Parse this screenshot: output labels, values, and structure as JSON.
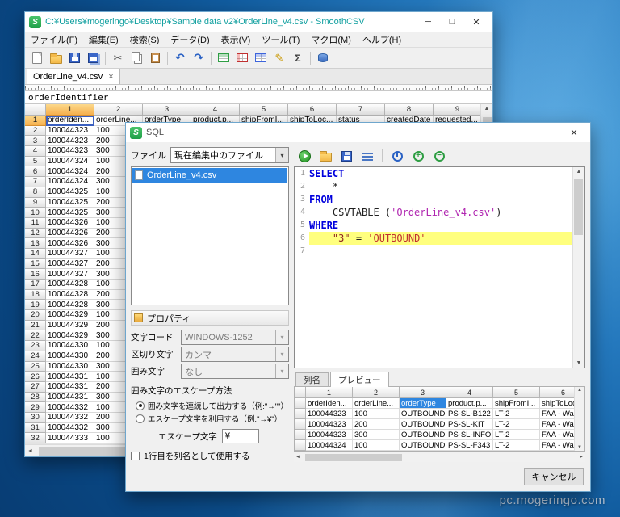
{
  "desktop": {
    "watermark": "pc.mogeringo.com"
  },
  "main_window": {
    "title": "C:¥Users¥mogeringo¥Desktop¥Sample data v2¥OrderLine_v4.csv - SmoothCSV",
    "logo_letter": "S",
    "window_buttons": {
      "minimize": "─",
      "maximize": "□",
      "close": "✕"
    },
    "menu": [
      {
        "name": "file",
        "label": "ファイル(F)"
      },
      {
        "name": "edit",
        "label": "編集(E)"
      },
      {
        "name": "search",
        "label": "検索(S)"
      },
      {
        "name": "data",
        "label": "データ(D)"
      },
      {
        "name": "view",
        "label": "表示(V)"
      },
      {
        "name": "tools",
        "label": "ツール(T)"
      },
      {
        "name": "macro",
        "label": "マクロ(M)"
      },
      {
        "name": "help",
        "label": "ヘルプ(H)"
      }
    ],
    "toolbar": [
      {
        "name": "new-file",
        "kind": "page"
      },
      {
        "name": "open-file",
        "kind": "folder"
      },
      {
        "name": "save",
        "kind": "floppy"
      },
      {
        "name": "save-all",
        "kind": "floppy2"
      },
      {
        "name": "sep1",
        "kind": "sep"
      },
      {
        "name": "cut",
        "kind": "cut",
        "glyph": "✂"
      },
      {
        "name": "copy",
        "kind": "copy"
      },
      {
        "name": "paste",
        "kind": "paste"
      },
      {
        "name": "sep2",
        "kind": "sep"
      },
      {
        "name": "undo",
        "kind": "undo",
        "glyph": "↶"
      },
      {
        "name": "redo",
        "kind": "redo",
        "glyph": "↷"
      },
      {
        "name": "sep3",
        "kind": "sep"
      },
      {
        "name": "insert-row",
        "kind": "tableg"
      },
      {
        "name": "delete-row",
        "kind": "tabler"
      },
      {
        "name": "insert-column",
        "kind": "tableb"
      },
      {
        "name": "edit-cell",
        "kind": "pencil",
        "glyph": "✎"
      },
      {
        "name": "sum",
        "kind": "sigma",
        "glyph": "Σ"
      },
      {
        "name": "sep4",
        "kind": "sep"
      },
      {
        "name": "sql",
        "kind": "db"
      }
    ],
    "tab": {
      "label": "OrderLine_v4.csv",
      "close": "×"
    },
    "cell_value": "orderIdentifier",
    "grid": {
      "column_headers": [
        "1",
        "2",
        "3",
        "4",
        "5",
        "6",
        "7",
        "8",
        "9"
      ],
      "selected": {
        "row_index": 0,
        "col_index": 0
      },
      "rows": [
        {
          "num": "1",
          "cells": [
            "orderIden...",
            "orderLine...",
            "orderType",
            "product.p...",
            "shipFromI...",
            "shipToLoc...",
            "status",
            "createdDate",
            "requested..."
          ]
        },
        {
          "num": "2",
          "cells": [
            "100044323",
            "100"
          ]
        },
        {
          "num": "3",
          "cells": [
            "100044323",
            "200"
          ]
        },
        {
          "num": "4",
          "cells": [
            "100044323",
            "300"
          ]
        },
        {
          "num": "5",
          "cells": [
            "100044324",
            "100"
          ]
        },
        {
          "num": "6",
          "cells": [
            "100044324",
            "200"
          ]
        },
        {
          "num": "7",
          "cells": [
            "100044324",
            "300"
          ]
        },
        {
          "num": "8",
          "cells": [
            "100044325",
            "100"
          ]
        },
        {
          "num": "9",
          "cells": [
            "100044325",
            "200"
          ]
        },
        {
          "num": "10",
          "cells": [
            "100044325",
            "300"
          ]
        },
        {
          "num": "11",
          "cells": [
            "100044326",
            "100"
          ]
        },
        {
          "num": "12",
          "cells": [
            "100044326",
            "200"
          ]
        },
        {
          "num": "13",
          "cells": [
            "100044326",
            "300"
          ]
        },
        {
          "num": "14",
          "cells": [
            "100044327",
            "100"
          ]
        },
        {
          "num": "15",
          "cells": [
            "100044327",
            "200"
          ]
        },
        {
          "num": "16",
          "cells": [
            "100044327",
            "300"
          ]
        },
        {
          "num": "17",
          "cells": [
            "100044328",
            "100"
          ]
        },
        {
          "num": "18",
          "cells": [
            "100044328",
            "200"
          ]
        },
        {
          "num": "19",
          "cells": [
            "100044328",
            "300"
          ]
        },
        {
          "num": "20",
          "cells": [
            "100044329",
            "100"
          ]
        },
        {
          "num": "21",
          "cells": [
            "100044329",
            "200"
          ]
        },
        {
          "num": "22",
          "cells": [
            "100044329",
            "300"
          ]
        },
        {
          "num": "23",
          "cells": [
            "100044330",
            "100"
          ]
        },
        {
          "num": "24",
          "cells": [
            "100044330",
            "200"
          ]
        },
        {
          "num": "25",
          "cells": [
            "100044330",
            "300"
          ]
        },
        {
          "num": "26",
          "cells": [
            "100044331",
            "100"
          ]
        },
        {
          "num": "27",
          "cells": [
            "100044331",
            "200"
          ]
        },
        {
          "num": "28",
          "cells": [
            "100044331",
            "300"
          ]
        },
        {
          "num": "29",
          "cells": [
            "100044332",
            "100"
          ]
        },
        {
          "num": "30",
          "cells": [
            "100044332",
            "200"
          ]
        },
        {
          "num": "31",
          "cells": [
            "100044332",
            "300"
          ]
        },
        {
          "num": "32",
          "cells": [
            "100044333",
            "100"
          ]
        }
      ]
    }
  },
  "sql_dialog": {
    "title": "SQL",
    "logo_letter": "S",
    "close": "✕",
    "file_section": {
      "label": "ファイル",
      "dropdown_value": "現在編集中のファイル",
      "files": [
        {
          "label": "OrderLine_v4.csv",
          "selected": true
        }
      ]
    },
    "toolbar": [
      {
        "name": "run-query",
        "kind": "play"
      },
      {
        "name": "open-sql",
        "kind": "folder"
      },
      {
        "name": "save-sql",
        "kind": "floppy"
      },
      {
        "name": "format-sql",
        "kind": "format"
      },
      {
        "name": "sep1",
        "kind": "sep"
      },
      {
        "name": "history",
        "kind": "clock"
      },
      {
        "name": "zoom-in",
        "kind": "zoom",
        "glyph": "+"
      },
      {
        "name": "zoom-out",
        "kind": "zoom",
        "glyph": "−"
      }
    ],
    "editor": {
      "lines": [
        {
          "num": "1",
          "tokens": [
            [
              "SELECT",
              "kw"
            ]
          ]
        },
        {
          "num": "2",
          "tokens": [
            [
              "    *",
              "plain"
            ]
          ]
        },
        {
          "num": "3",
          "tokens": [
            [
              "FROM",
              "kw"
            ]
          ]
        },
        {
          "num": "4",
          "tokens": [
            [
              "    CSVTABLE (",
              "plain"
            ],
            [
              "'OrderLine_v4.csv'",
              "str"
            ],
            [
              ")",
              "plain"
            ]
          ]
        },
        {
          "num": "5",
          "tokens": [
            [
              "WHERE",
              "kw"
            ]
          ]
        },
        {
          "num": "6",
          "tokens": [
            [
              "    ",
              "plain"
            ],
            [
              "\"3\"",
              "col"
            ],
            [
              " = ",
              "plain"
            ],
            [
              "'OUTBOUND'",
              "val"
            ]
          ],
          "current": true
        },
        {
          "num": "7",
          "tokens": []
        }
      ]
    },
    "properties": {
      "title": "プロパティ",
      "fields": [
        {
          "name": "charset",
          "label": "文字コード",
          "value": "WINDOWS-1252"
        },
        {
          "name": "delimiter",
          "label": "区切り文字",
          "value": "カンマ"
        },
        {
          "name": "quote",
          "label": "囲み文字",
          "value": "なし"
        }
      ],
      "escape_group_label": "囲み文字のエスケープ方法",
      "radios": [
        {
          "name": "repeat-quote",
          "label": "囲み文字を連続して出力する（例:\"→\"\"）",
          "checked": true
        },
        {
          "name": "use-escape-char",
          "label": "エスケープ文字を利用する（例:\"→¥\"）",
          "checked": false
        }
      ],
      "escape_char_label": "エスケープ文字",
      "escape_char_value": "¥",
      "first_row_checkbox": {
        "label": "1行目を列名として使用する",
        "checked": false
      }
    },
    "result_tabs": [
      {
        "name": "columns",
        "label": "列名",
        "active": false
      },
      {
        "name": "preview",
        "label": "プレビュー",
        "active": true
      }
    ],
    "preview": {
      "column_headers": [
        "1",
        "2",
        "3",
        "4",
        "5",
        "6"
      ],
      "selected": {
        "row": 0,
        "col": 2
      },
      "rows": [
        [
          "orderIden...",
          "orderLine...",
          "orderType",
          "product.p...",
          "shipFromI...",
          "shipToLoc..."
        ],
        [
          "100044323",
          "100",
          "OUTBOUND",
          "PS-SL-B122",
          "LT-2",
          "FAA - Was..."
        ],
        [
          "100044323",
          "200",
          "OUTBOUND",
          "PS-SL-KIT",
          "LT-2",
          "FAA - Was..."
        ],
        [
          "100044323",
          "300",
          "OUTBOUND",
          "PS-SL-INFO",
          "LT-2",
          "FAA - Was..."
        ],
        [
          "100044324",
          "100",
          "OUTBOUND",
          "PS-SL-F343",
          "LT-2",
          "FAA - Was..."
        ]
      ]
    },
    "cancel_label": "キャンセル"
  }
}
